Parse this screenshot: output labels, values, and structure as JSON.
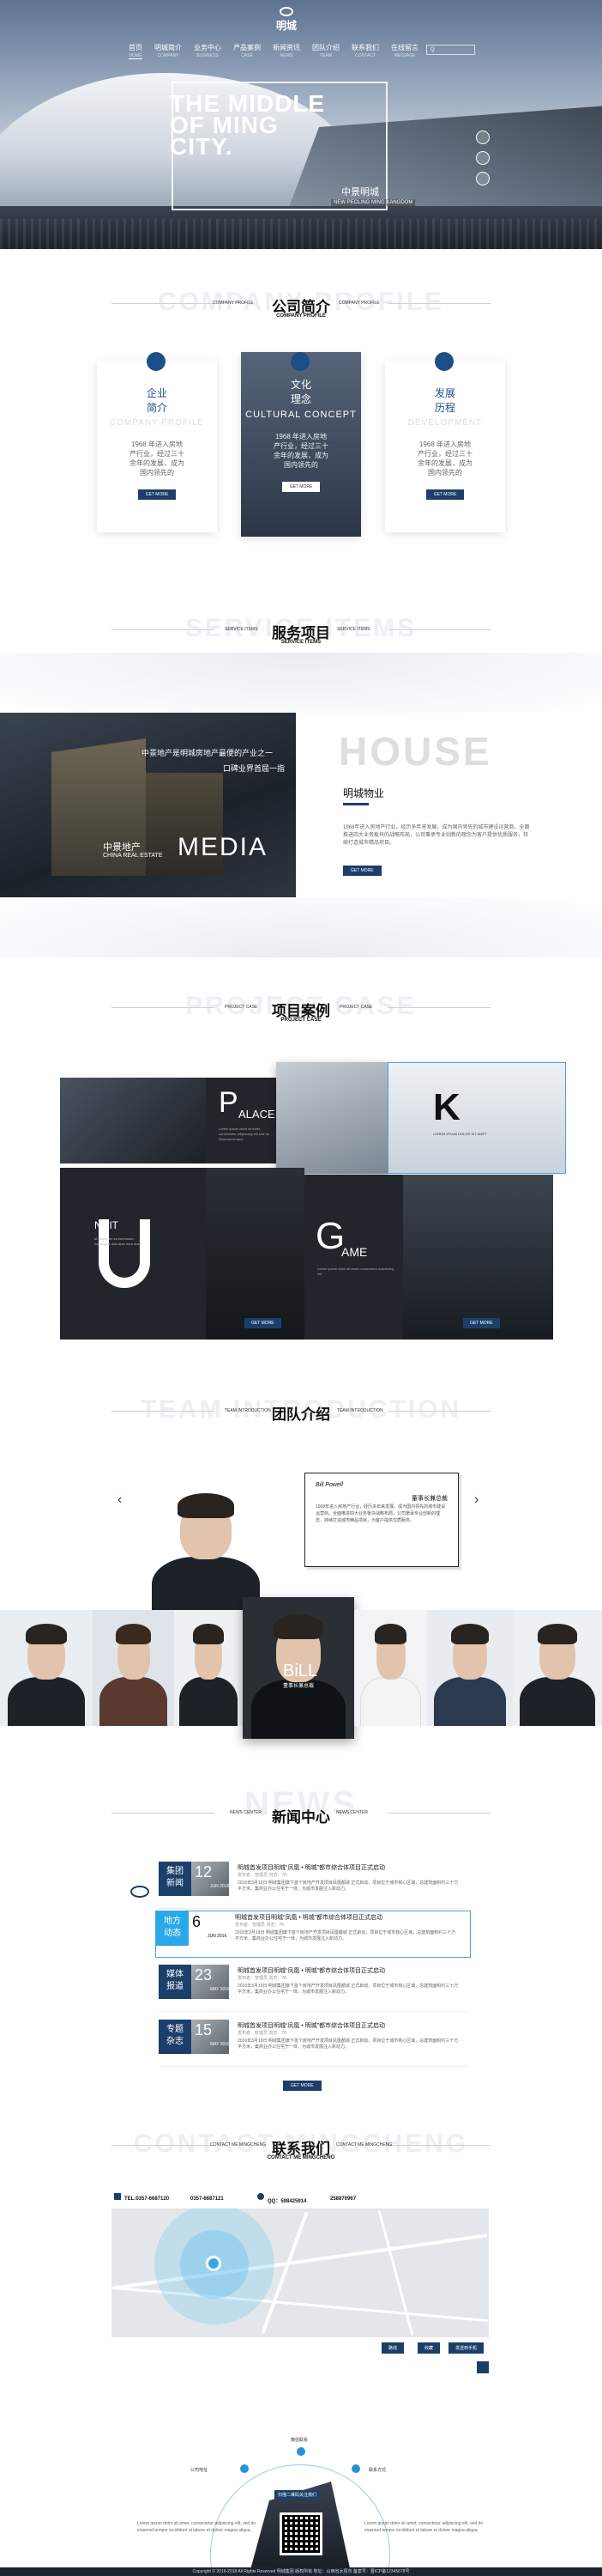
{
  "header": {
    "logo_text": "明城",
    "nav": [
      {
        "cn": "首页",
        "en": "HOME"
      },
      {
        "cn": "明城简介",
        "en": "COMPANY"
      },
      {
        "cn": "业务中心",
        "en": "BUSINESS"
      },
      {
        "cn": "产品案例",
        "en": "CASE"
      },
      {
        "cn": "新闻资讯",
        "en": "NEWS"
      },
      {
        "cn": "团队介绍",
        "en": "TEAM"
      },
      {
        "cn": "联系我们",
        "en": "CONTACT"
      },
      {
        "cn": "在线留言",
        "en": "MESSAGE"
      }
    ],
    "search_placeholder": "Q"
  },
  "hero": {
    "title_line1": "THE MIDDLE",
    "title_line2": "OF MING",
    "title_line3": "CITY.",
    "cn": "中景明城",
    "en": "NEW PEOLING MING KANGDOM"
  },
  "profile": {
    "bg": "COMPANY PROFILE",
    "cn": "公司简介",
    "en": "COMPANY PROFILE",
    "side_left": "COMPANY PROFILE",
    "side_right": "COMPANY PROFILE",
    "cards": [
      {
        "title_l1": "企业",
        "title_l2": "简介",
        "en": "COMPANY PROFILE",
        "text": "1968 年进入房地产行业，经过三十余年的发展，成为国内领先的",
        "btn": "GET MORE"
      },
      {
        "title_l1": "文化",
        "title_l2": "理念",
        "en": "CULTURAL CONCEPT",
        "text": "1968 年进入房地产行业，经过三十余年的发展，成为国内领先的",
        "btn": "GET MORE"
      },
      {
        "title_l1": "发展",
        "title_l2": "历程",
        "en": "DEVELOPMENT",
        "text": "1968 年进入房地产行业，经过三十余年的发展，成为国内领先的",
        "btn": "GET MORE"
      }
    ]
  },
  "service": {
    "bg": "SERVICE ITEMS",
    "cn": "服务项目",
    "en": "SERVICE ITEMS",
    "side_left": "SERVICE ITEMS",
    "side_right": "SERVICE ITEMS",
    "slogan1": "中景地产是明城房地产最便的产业之一",
    "slogan2": "口碑业界首屈一指",
    "media_cn": "中景地产",
    "media_en": "CHINA REAL ESTATE",
    "media": "MEDIA",
    "house": "HOUSE",
    "house_title": "明城物业",
    "house_text": "1968年进入房地产行业，经历多年来发展，成为国内领先的城市建设运营商，全面推进四大业务板块的战略布局，公司秉承专业创新的理念为客户提供优质服务，持续打造城市精品项目。",
    "btn": "GET MORE"
  },
  "cases": {
    "bg": "PROJECT CASE",
    "cn": "项目案例",
    "en": "PROJECT CASE",
    "side_left": "PROJECT CASE",
    "side_right": "PROJECT CASE",
    "palace_letter": "P",
    "palace_word": "ALACE",
    "palace_text": "Lorem ipsum dolor sit amet consectetur adipiscing elit sed do eiusmod tempor",
    "k_letter": "K",
    "k_text": "LOREM IPSUM DOLOR SIT AMET",
    "nuit": "NUIT",
    "nuit_letter": "U",
    "nuit_text": "ut aliquip ex ea commodo consequat duis aute irure dolor",
    "game_letter": "G",
    "game_word": "AME",
    "game_text": "Lorem ipsum dolor sit amet consectetur adipiscing elit",
    "btn": "GET MORE"
  },
  "team": {
    "bg": "TEAM INTRODUCTION",
    "cn": "团队介绍",
    "side_left": "TEAM INTRODUCTION",
    "side_right": "TEAM INTRODUCTION",
    "card_sign": "Bill Powell",
    "card_role": "董事长兼总裁",
    "card_text": "1968年进入房地产行业，经历多年来发展，成为国内领先的城市建设运营商。全面推进四大业务板块战略布局，公司秉承专业创新的理念，持续打造城市精品项目，为客户提供优质服务。",
    "prev": "‹",
    "next": "›",
    "bill": "BiLL",
    "bill_sub": "董事长兼总裁"
  },
  "news": {
    "bg": "NEWS",
    "cn": "新闻中心",
    "side_left": "NEWS CENTER",
    "side_right": "NEWS CENTER",
    "items": [
      {
        "tag_l1": "集团",
        "tag_l2": "新闻",
        "day": "12",
        "mon": "JUN 2016",
        "title": "明城首发项目明城“凤凰 • 明城”都市综合体项目正式启动",
        "meta": "发布者：管理员  浏览：78  ",
        "desc": "2016年3月19日 明城集团旗下首个房地产开发项目凤凰都城 正式启动，项目位于城市核心区域，总建筑面积约三十万平方米，集商业办公住宅于一体，为城市发展注入新动力。"
      },
      {
        "tag_l1": "地方",
        "tag_l2": "动态",
        "day": "6",
        "mon": "JUN 2016",
        "title": "明城首发项目明城“凤凰 • 明城”都市综合体项目正式启动",
        "meta": "发布者：管理员  浏览：78  ",
        "desc": "2016年3月19日 明城集团旗下首个房地产开发项目凤凰都城 正式启动，项目位于城市核心区域，总建筑面积约三十万平方米，集商业办公住宅于一体，为城市发展注入新动力。"
      },
      {
        "tag_l1": "媒体",
        "tag_l2": "报道",
        "day": "23",
        "mon": "MAY 2016",
        "title": "明城首发项目明城“凤凰 • 明城”都市综合体项目正式启动",
        "meta": "发布者：管理员  浏览：78  ",
        "desc": "2016年3月19日 明城集团旗下首个房地产开发项目凤凰都城 正式启动，项目位于城市核心区域，总建筑面积约三十万平方米，集商业办公住宅于一体，为城市发展注入新动力。"
      },
      {
        "tag_l1": "专题",
        "tag_l2": "杂志",
        "day": "15",
        "mon": "MAY 2016",
        "title": "明城首发项目明城“凤凰 • 明城”都市综合体项目正式启动",
        "meta": "发布者：管理员  浏览：78  ",
        "desc": "2016年3月19日 明城集团旗下首个房地产开发项目凤凰都城 正式启动，项目位于城市核心区域，总建筑面积约三十万平方米，集商业办公住宅于一体，为城市发展注入新动力。"
      }
    ],
    "btn": "GET MORE"
  },
  "contact": {
    "bg": "CONTACT MINGCHENG",
    "cn": "联系我们",
    "en": "CONTACT ME MINGCHENG",
    "side_left": "CONTACT ME MINGCHENG",
    "side_right": "CONTACT ME MINGCHENG",
    "tel_label": "TEL:0357-6687120",
    "tel2": "0357-6687121",
    "qq_label": "QQ：598425914",
    "qq2": "258870967",
    "map_btn1": "路线",
    "map_btn2": "收藏",
    "map_btn3": "发送到手机"
  },
  "footer": {
    "label_top": "微信联系",
    "label_left": "公司地址",
    "label_right": "联系方式",
    "left_text": "Lorem ipsum dolor sit amet, consectetur adipiscing elit, sed do eiusmod tempor incididunt ut labore et dolore magna aliqua.",
    "right_text": "Lorem ipsum dolor sit amet, consectetur adipiscing elit, sed do eiusmod tempor incididunt ut labore et dolore magna aliqua.",
    "qr_caption": "扫描二维码关注我们",
    "copyright": "Copyright © 2016-2018 All Rights Reserved  明城集团 版权所有  地址：山西省太原市  备案号：晋ICP备12345678号"
  }
}
